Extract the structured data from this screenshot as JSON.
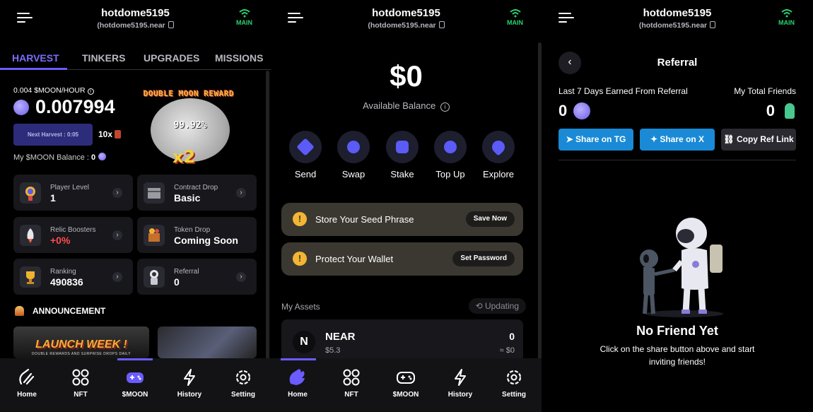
{
  "header": {
    "username": "hotdome5195",
    "account": "(hotdome5195.near",
    "network": "MAIN"
  },
  "harvest": {
    "tabs": [
      "HARVEST",
      "TINKERS",
      "UPGRADES",
      "MISSIONS"
    ],
    "rate": "0.004 $MOON/HOUR",
    "value": "0.007994",
    "next_harvest": "Next Harvest : 0:05",
    "multiplier": "10x",
    "balance_label": "My $MOON Balance :",
    "balance_value": "0",
    "moon_reward_title": "DOUBLE MOON REWARD",
    "moon_percent": "99.92%",
    "moon_multiplier": "x2",
    "cards": [
      {
        "label": "Player Level",
        "value": "1"
      },
      {
        "label": "Contract Drop",
        "value": "Basic"
      },
      {
        "label": "Relic Boosters",
        "value": "+0%"
      },
      {
        "label": "Token Drop",
        "value": "Coming Soon"
      },
      {
        "label": "Ranking",
        "value": "490836"
      },
      {
        "label": "Referral",
        "value": "0"
      }
    ],
    "announcement": "ANNOUNCEMENT",
    "banner_title": "LAUNCH WEEK !",
    "banner_sub": "DOUBLE REWARDS AND SURPRISE DROPS DAILY",
    "nav": [
      "Home",
      "NFT",
      "$MOON",
      "History",
      "Setting"
    ]
  },
  "wallet": {
    "balance": "$0",
    "balance_label": "Available Balance",
    "actions": [
      "Send",
      "Swap",
      "Stake",
      "Top Up",
      "Explore"
    ],
    "alerts": [
      {
        "text": "Store Your Seed Phrase",
        "button": "Save Now"
      },
      {
        "text": "Protect Your Wallet",
        "button": "Set Password"
      }
    ],
    "assets_label": "My Assets",
    "updating": "Updating",
    "asset": {
      "name": "NEAR",
      "price": "$5.3",
      "amount": "0",
      "usd": "≈ $0"
    },
    "nav": [
      "Home",
      "NFT",
      "$MOON",
      "History",
      "Setting"
    ]
  },
  "referral": {
    "title": "Referral",
    "earned_label": "Last 7 Days Earned From Referral",
    "earned_value": "0",
    "friends_label": "My Total Friends",
    "friends_value": "0",
    "share_tg": "Share on TG",
    "share_x": "Share on X",
    "copy_link": "Copy Ref Link",
    "empty_title": "No Friend Yet",
    "empty_sub": "Click on the share button above and start inviting friends!"
  },
  "colors": {
    "accent": "#6b5cff",
    "network": "#29d26f",
    "share": "#1a8ad6",
    "warning": "#f2b534"
  }
}
